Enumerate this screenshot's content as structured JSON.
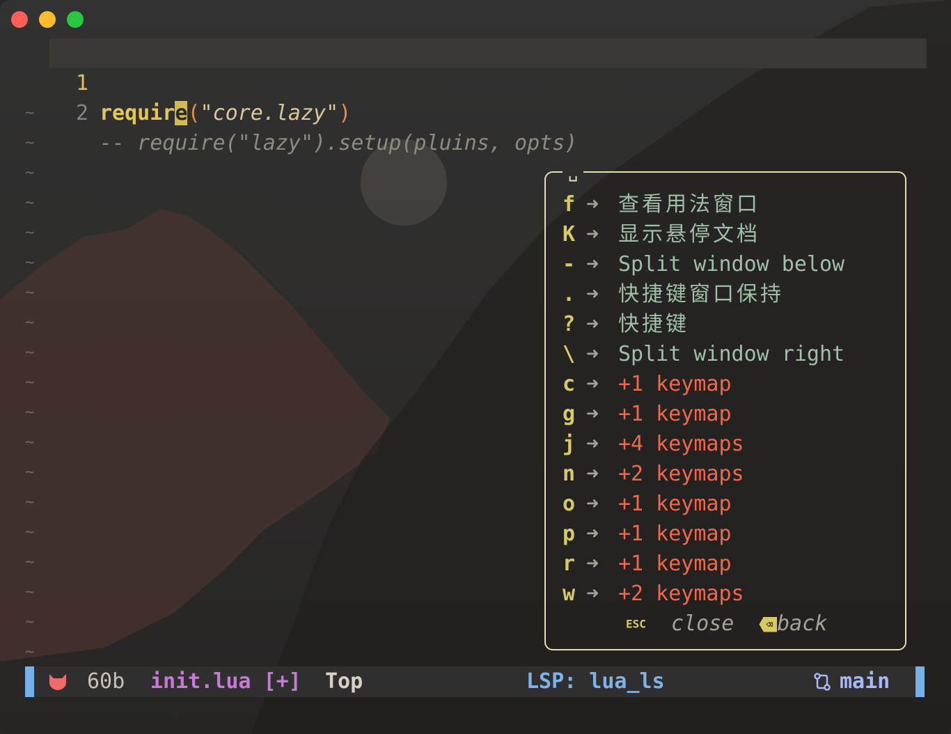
{
  "window": {
    "controls": [
      "close",
      "minimize",
      "zoom"
    ],
    "background_art": [
      "moon",
      "mountains"
    ]
  },
  "editor": {
    "lines": [
      {
        "number": "1",
        "keyword": "require",
        "keyword_before_cursor": "requir",
        "cursor_char": "e",
        "open_paren": "(",
        "string": "\"core.lazy\"",
        "close_paren": ")"
      },
      {
        "number": "2",
        "text": "-- require(\"lazy\").setup(pluins, opts)"
      }
    ],
    "empty_marker": "~"
  },
  "popup": {
    "title": "␣",
    "entries": [
      {
        "key": "f",
        "desc": "查看用法窗口",
        "kind": "cmd"
      },
      {
        "key": "K",
        "desc": "显示悬停文档",
        "kind": "cmd"
      },
      {
        "key": "-",
        "desc": "Split window below",
        "kind": "cmd"
      },
      {
        "key": ".",
        "desc": "快捷键窗口保持",
        "kind": "cmd"
      },
      {
        "key": "?",
        "desc": "快捷键",
        "kind": "cmd"
      },
      {
        "key": "\\",
        "desc": "Split window right",
        "kind": "cmd"
      },
      {
        "key": "c",
        "desc": "+1 keymap",
        "kind": "group"
      },
      {
        "key": "g",
        "desc": "+1 keymap",
        "kind": "group"
      },
      {
        "key": "j",
        "desc": "+4 keymaps",
        "kind": "group"
      },
      {
        "key": "n",
        "desc": "+2 keymaps",
        "kind": "group"
      },
      {
        "key": "o",
        "desc": "+1 keymap",
        "kind": "group"
      },
      {
        "key": "p",
        "desc": "+1 keymap",
        "kind": "group"
      },
      {
        "key": "r",
        "desc": "+1 keymap",
        "kind": "group"
      },
      {
        "key": "w",
        "desc": "+2 keymaps",
        "kind": "group"
      }
    ],
    "arrow": "➜",
    "footer": {
      "esc_key": "ESC",
      "close_label": "close",
      "backspace_key": "⌫",
      "back_label": "back"
    }
  },
  "statusbar": {
    "mode_icon": "cat-icon",
    "size": "60b",
    "file": "init.lua [+]",
    "position": "Top",
    "lsp": "LSP: lua_ls",
    "branch_icon": "git-branch-icon",
    "branch": "main"
  },
  "colors": {
    "keyword": "#e3c659",
    "paren": "#ed8c48",
    "group_desc": "#f0674b",
    "cmd_desc": "#9fbfa8",
    "key": "#d7c965",
    "file": "#c779d6",
    "lsp": "#7fb3e6",
    "separator": "#76b0e8"
  }
}
